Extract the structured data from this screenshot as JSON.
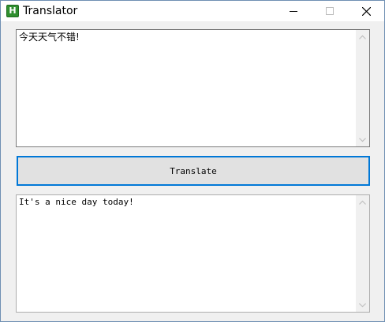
{
  "window": {
    "title": "Translator",
    "app_icon_letter": "H",
    "controls": [
      "minimize-icon",
      "maximize-icon",
      "close-icon"
    ]
  },
  "source": {
    "text": "今天天气不错!"
  },
  "translate_button": {
    "label": "Translate"
  },
  "output": {
    "text": "It's a nice day today!"
  },
  "colors": {
    "accent_focus": "#0078d7",
    "app_icon": "#2f8f2f",
    "chrome": "#f0f0f0"
  }
}
